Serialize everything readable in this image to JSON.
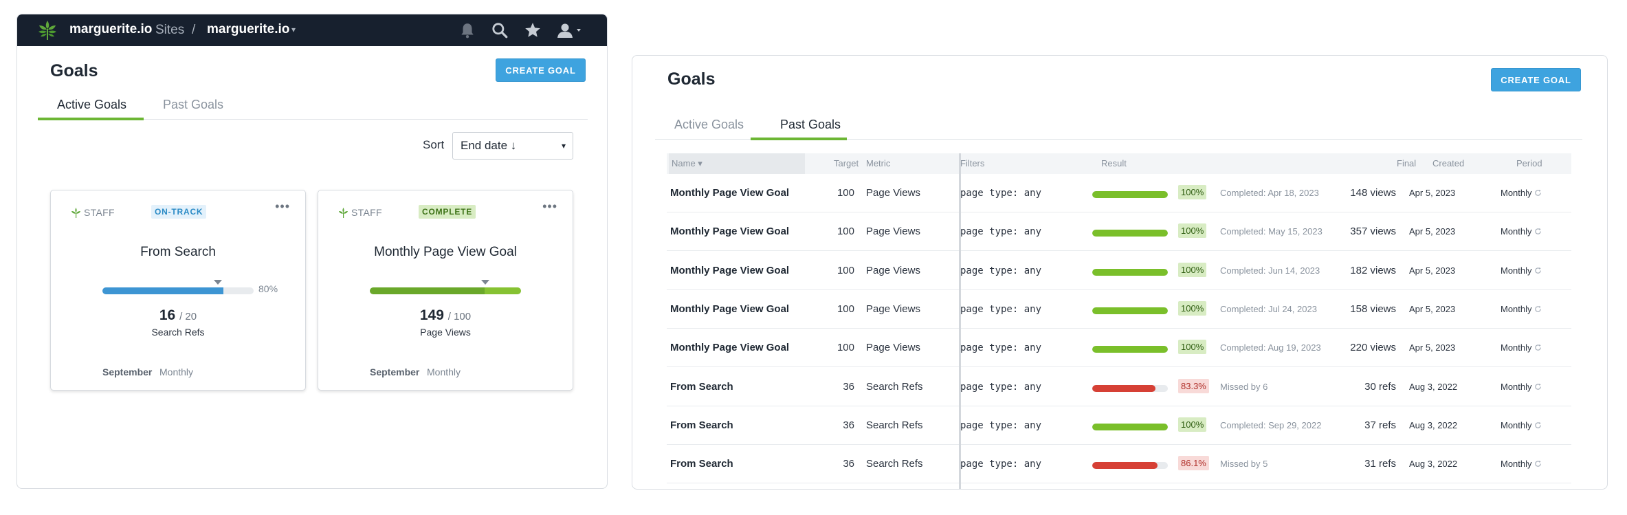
{
  "colors": {
    "topbar": "#17202e",
    "accent_blue": "#3ea3df",
    "green": "#6cb634",
    "red": "#d64035",
    "bar_blue": "#3d95d3"
  },
  "topbar": {
    "brand": "marguerite.io",
    "crumb_sites": "Sites",
    "crumb_sep": "/",
    "crumb_site": "marguerite.io",
    "crumb_caret": "▾",
    "icons": [
      "bell-icon",
      "search-icon",
      "star-icon",
      "user-icon"
    ]
  },
  "left": {
    "title": "Goals",
    "create_label": "CREATE GOAL",
    "tabs": [
      {
        "label": "Active Goals"
      },
      {
        "label": "Past Goals"
      }
    ],
    "sort_label": "Sort",
    "sort_value": "End date ↓",
    "sort_caret": "▾",
    "cards": [
      {
        "staff": "STAFF",
        "badge": "ON-TRACK",
        "menu": "•••",
        "title": "From Search",
        "progress": 0.8,
        "marker": 0.76,
        "pct": "80%",
        "value": "16",
        "target": "/ 20",
        "metric": "Search Refs",
        "month": "September",
        "period": "Monthly"
      },
      {
        "staff": "STAFF",
        "badge": "COMPLETE",
        "menu": "•••",
        "title": "Monthly Page View Goal",
        "progress": 1.0,
        "marker": 0.76,
        "pct": "",
        "value": "149",
        "target": "/ 100",
        "metric": "Page Views",
        "month": "September",
        "period": "Monthly"
      }
    ]
  },
  "right": {
    "title": "Goals",
    "create_label": "CREATE GOAL",
    "tabs": [
      {
        "label": "Active Goals"
      },
      {
        "label": "Past Goals"
      }
    ],
    "headers": {
      "name": "Name ▾",
      "target": "Target",
      "metric": "Metric",
      "filters": "Filters",
      "result": "Result",
      "final": "Final",
      "created": "Created",
      "period": "Period"
    },
    "rows": [
      {
        "name": "Monthly Page View Goal",
        "target": "100",
        "metric": "Page Views",
        "filter": "page type: any",
        "progress": 1.0,
        "pct": "100%",
        "ok": true,
        "status": "Completed: Apr 18, 2023",
        "final": "148 views",
        "created": "Apr 5, 2023",
        "period": "Monthly"
      },
      {
        "name": "Monthly Page View Goal",
        "target": "100",
        "metric": "Page Views",
        "filter": "page type: any",
        "progress": 1.0,
        "pct": "100%",
        "ok": true,
        "status": "Completed: May 15, 2023",
        "final": "357 views",
        "created": "Apr 5, 2023",
        "period": "Monthly"
      },
      {
        "name": "Monthly Page View Goal",
        "target": "100",
        "metric": "Page Views",
        "filter": "page type: any",
        "progress": 1.0,
        "pct": "100%",
        "ok": true,
        "status": "Completed: Jun 14, 2023",
        "final": "182 views",
        "created": "Apr 5, 2023",
        "period": "Monthly"
      },
      {
        "name": "Monthly Page View Goal",
        "target": "100",
        "metric": "Page Views",
        "filter": "page type: any",
        "progress": 1.0,
        "pct": "100%",
        "ok": true,
        "status": "Completed: Jul 24, 2023",
        "final": "158 views",
        "created": "Apr 5, 2023",
        "period": "Monthly"
      },
      {
        "name": "Monthly Page View Goal",
        "target": "100",
        "metric": "Page Views",
        "filter": "page type: any",
        "progress": 1.0,
        "pct": "100%",
        "ok": true,
        "status": "Completed: Aug 19, 2023",
        "final": "220 views",
        "created": "Apr 5, 2023",
        "period": "Monthly"
      },
      {
        "name": "From Search",
        "target": "36",
        "metric": "Search Refs",
        "filter": "page type: any",
        "progress": 0.833,
        "pct": "83.3%",
        "ok": false,
        "status": "Missed by 6",
        "final": "30 refs",
        "created": "Aug 3, 2022",
        "period": "Monthly"
      },
      {
        "name": "From Search",
        "target": "36",
        "metric": "Search Refs",
        "filter": "page type: any",
        "progress": 1.0,
        "pct": "100%",
        "ok": true,
        "status": "Completed: Sep 29, 2022",
        "final": "37 refs",
        "created": "Aug 3, 2022",
        "period": "Monthly"
      },
      {
        "name": "From Search",
        "target": "36",
        "metric": "Search Refs",
        "filter": "page type: any",
        "progress": 0.861,
        "pct": "86.1%",
        "ok": false,
        "status": "Missed by 5",
        "final": "31 refs",
        "created": "Aug 3, 2022",
        "period": "Monthly"
      }
    ]
  }
}
